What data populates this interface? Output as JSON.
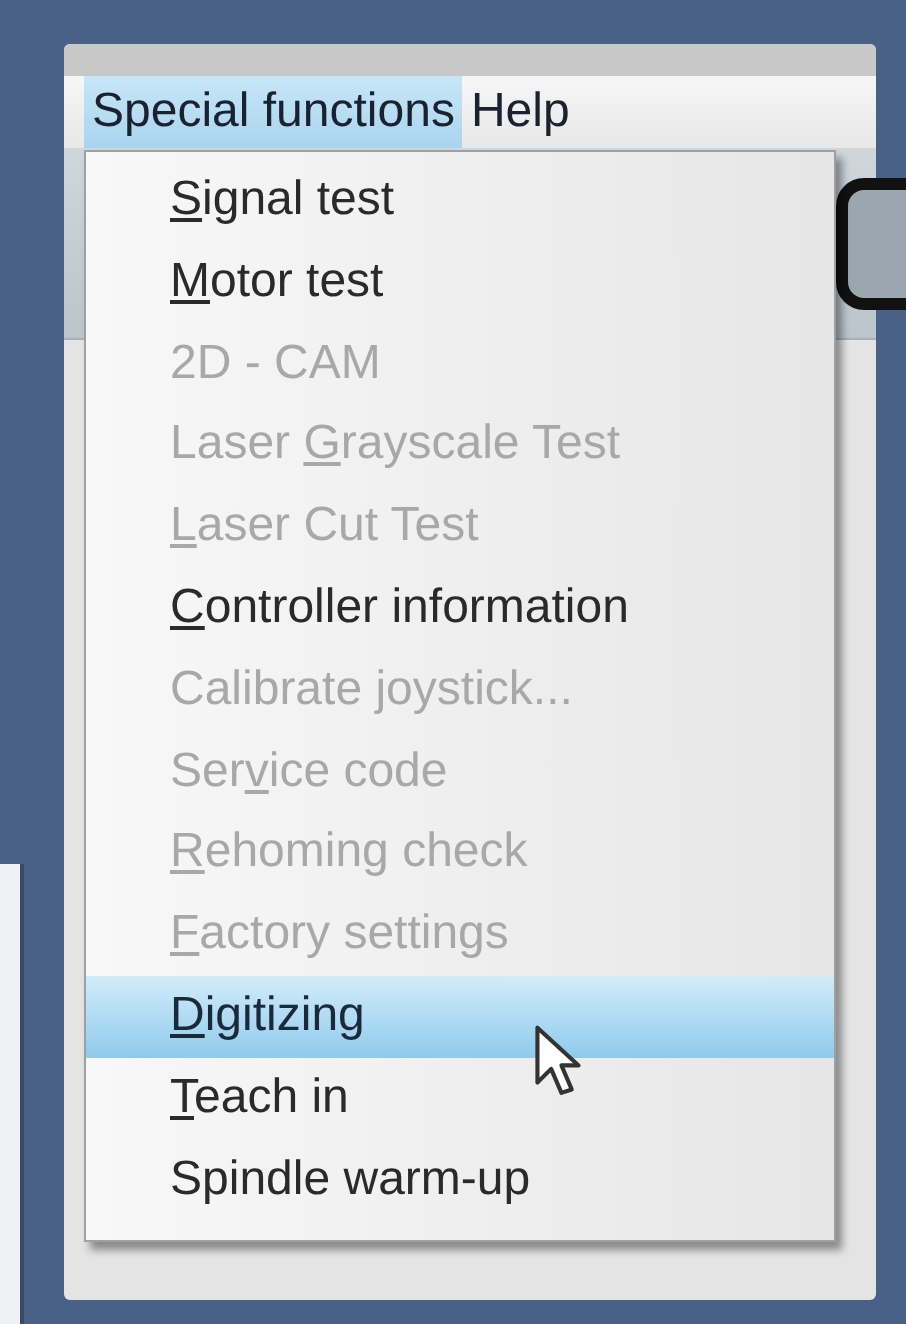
{
  "menubar": [
    {
      "label": "Special functions",
      "selected": true
    },
    {
      "label": "Help",
      "selected": false
    }
  ],
  "menu": {
    "items": [
      {
        "key": "S",
        "post": "ignal test",
        "disabled": false,
        "selected": false
      },
      {
        "key": "M",
        "post": "otor test",
        "disabled": false,
        "selected": false
      },
      {
        "pre": "2D - CAM",
        "disabled": true,
        "selected": false
      },
      {
        "pre": "Laser ",
        "key": "G",
        "post": "rayscale Test",
        "disabled": true,
        "selected": false
      },
      {
        "key": "L",
        "post": "aser Cut Test",
        "disabled": true,
        "selected": false
      },
      {
        "key": "C",
        "post": "ontroller information",
        "disabled": false,
        "selected": false
      },
      {
        "pre": "Calibrate joystick...",
        "disabled": true,
        "selected": false
      },
      {
        "pre": "Ser",
        "key": "v",
        "post": "ice code",
        "disabled": true,
        "selected": false
      },
      {
        "key": "R",
        "post": "ehoming check",
        "disabled": true,
        "selected": false
      },
      {
        "key": "F",
        "post": "actory settings",
        "disabled": true,
        "selected": false
      },
      {
        "key": "D",
        "post": "igitizing",
        "disabled": false,
        "selected": true
      },
      {
        "key": "T",
        "post": "each in",
        "disabled": false,
        "selected": false
      },
      {
        "pre": "Spindle warm-up",
        "disabled": false,
        "selected": false
      }
    ]
  }
}
